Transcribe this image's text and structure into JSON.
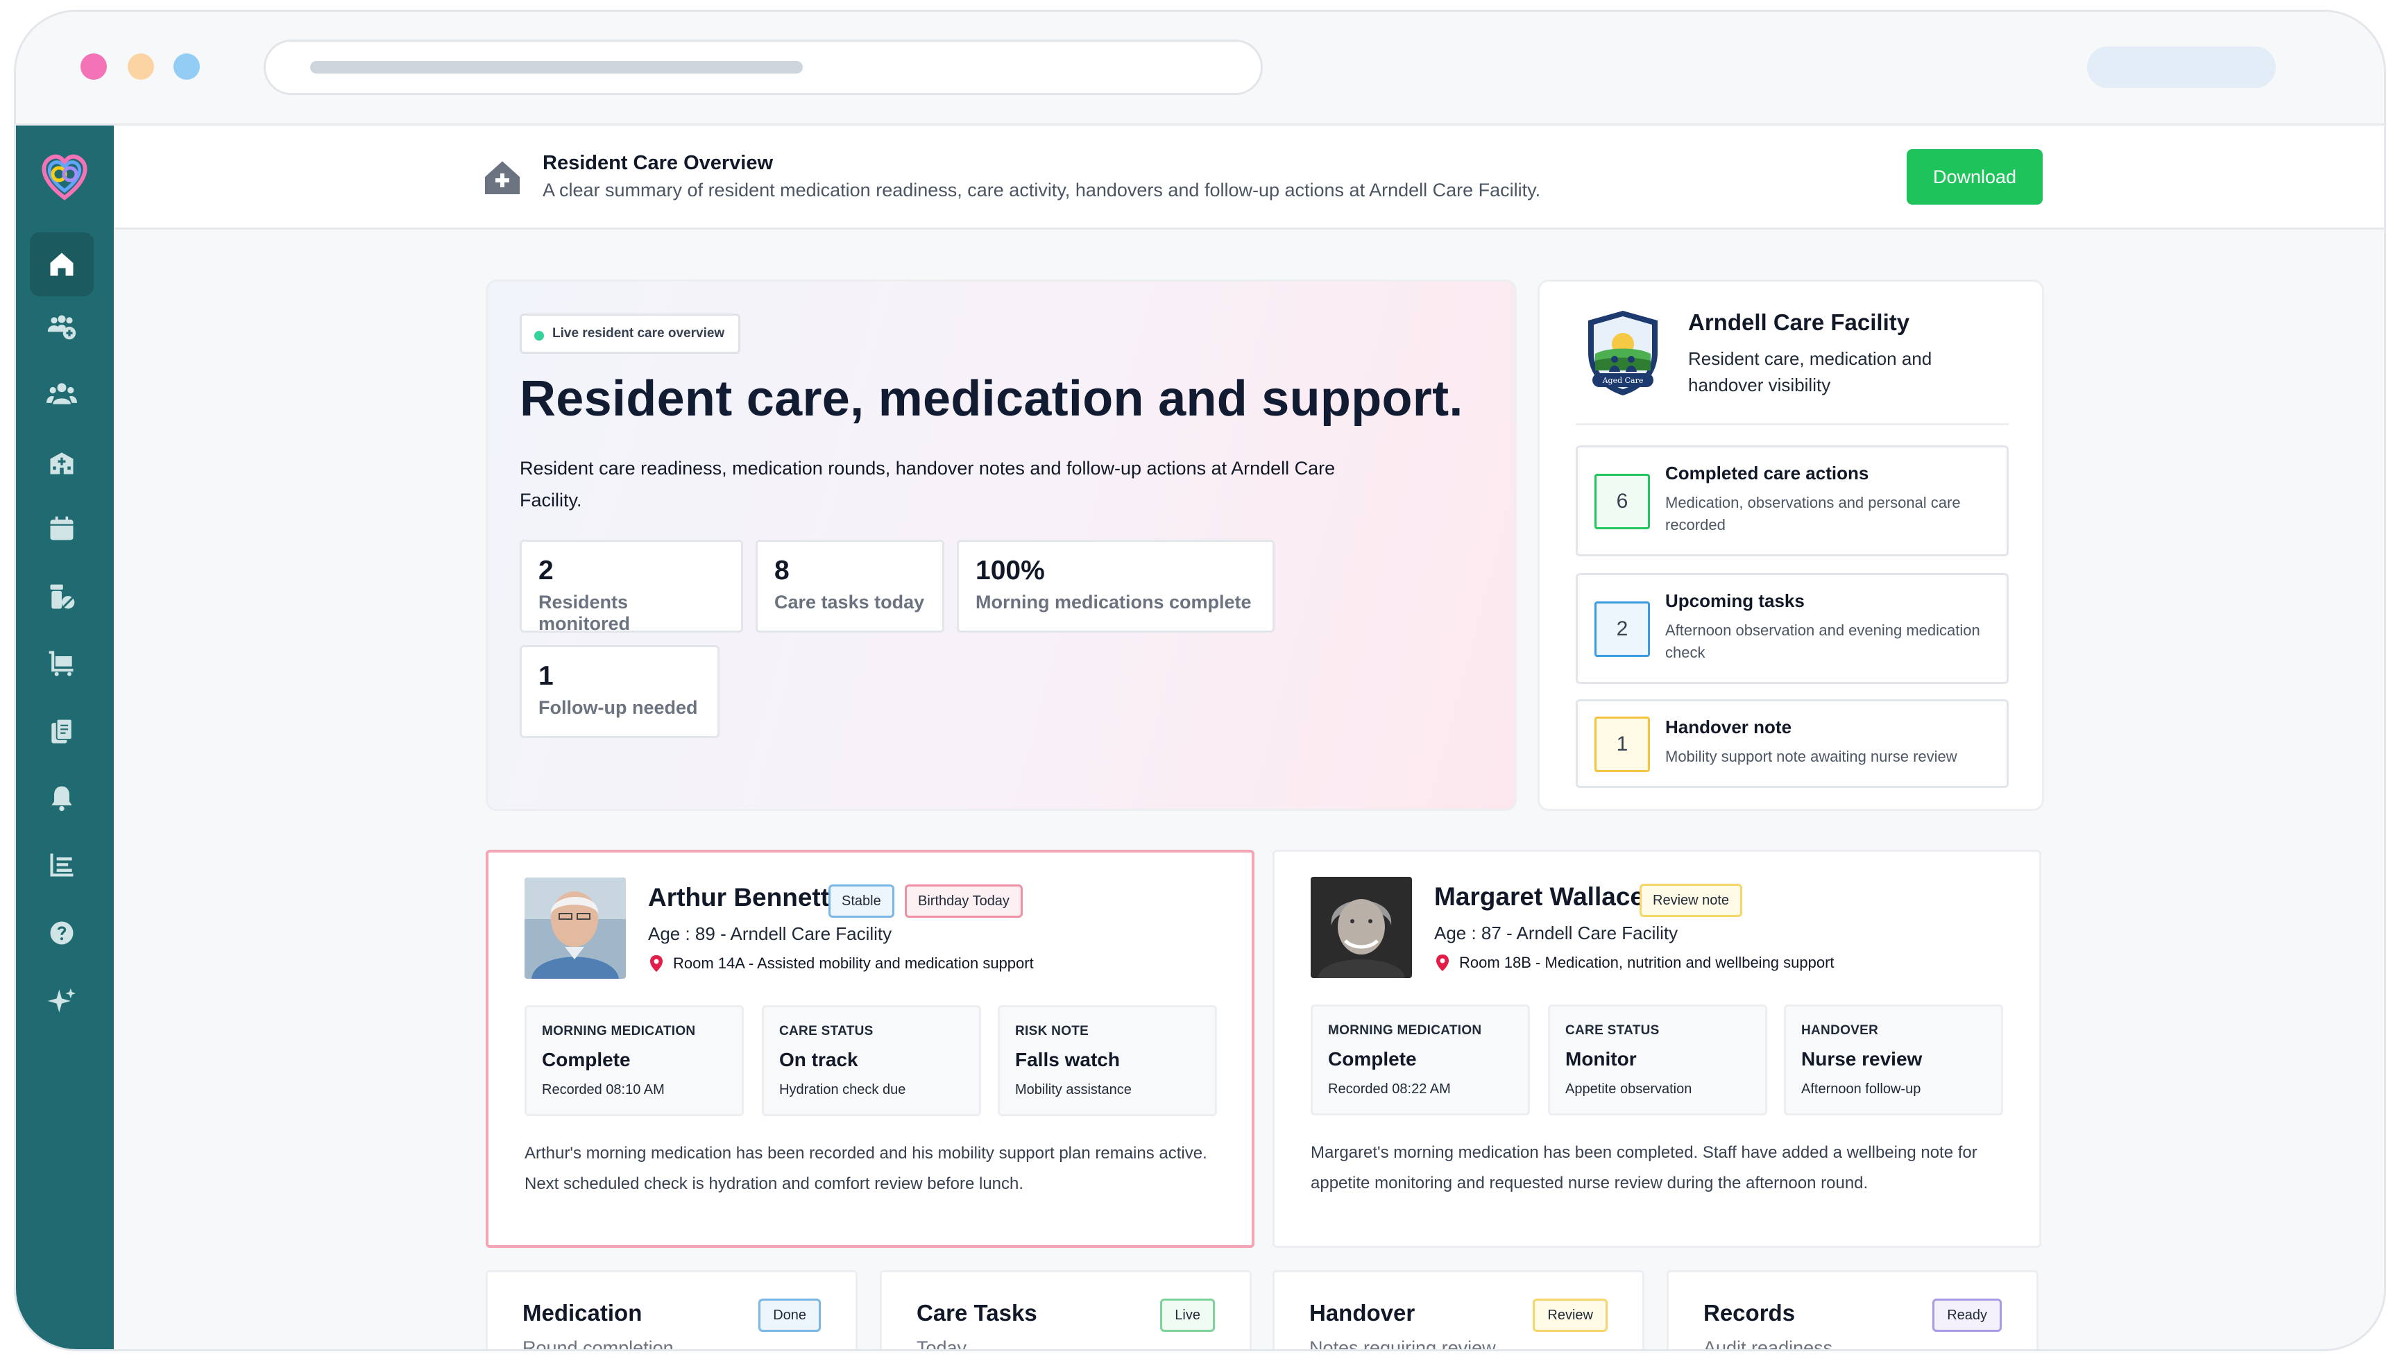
{
  "header": {
    "title": "Resident Care Overview",
    "subtitle": "A clear summary of resident medication readiness, care activity, handovers and follow-up actions at Arndell Care Facility.",
    "download_label": "Download"
  },
  "sidebar": {
    "items": [
      {
        "icon": "home-icon",
        "active": true
      },
      {
        "icon": "add-group-icon"
      },
      {
        "icon": "users-icon"
      },
      {
        "icon": "building-icon"
      },
      {
        "icon": "calendar-icon"
      },
      {
        "icon": "medication-icon"
      },
      {
        "icon": "cart-icon"
      },
      {
        "icon": "documents-icon"
      },
      {
        "icon": "bell-icon"
      },
      {
        "icon": "list-icon"
      },
      {
        "icon": "help-icon"
      },
      {
        "icon": "sparkle-icon"
      }
    ]
  },
  "hero": {
    "live_label": "Live resident care overview",
    "heading": "Resident care, medication and support.",
    "lead": "Resident care readiness, medication rounds, handover notes and follow-up actions at Arndell Care Facility.",
    "stats": [
      {
        "value": "2",
        "label": "Residents monitored"
      },
      {
        "value": "8",
        "label": "Care tasks today"
      },
      {
        "value": "100%",
        "label": "Morning medications complete"
      },
      {
        "value": "1",
        "label": "Follow-up needed"
      }
    ]
  },
  "facility": {
    "seal_text": "Aged Care",
    "name": "Arndell Care Facility",
    "description": "Resident care, medication and handover visibility",
    "tasks": [
      {
        "count": "6",
        "title": "Completed care actions",
        "detail": "Medication, observations and personal care recorded",
        "color": "#22c55e"
      },
      {
        "count": "2",
        "title": "Upcoming tasks",
        "detail": "Afternoon observation and evening medication check",
        "color": "#3b9be0"
      },
      {
        "count": "1",
        "title": "Handover note",
        "detail": "Mobility support note awaiting nurse review",
        "color": "#f5c542"
      }
    ]
  },
  "residents": [
    {
      "name": "Arthur Bennett",
      "tags": [
        "Stable",
        "Birthday Today"
      ],
      "age_line": "Age : 89 - Arndell Care Facility",
      "room": "Room 14A - Assisted mobility and medication support",
      "metrics": [
        {
          "key": "MORNING MEDICATION",
          "value": "Complete",
          "sub": "Recorded 08:10 AM"
        },
        {
          "key": "CARE STATUS",
          "value": "On track",
          "sub": "Hydration check due"
        },
        {
          "key": "RISK NOTE",
          "value": "Falls watch",
          "sub": "Mobility assistance"
        }
      ],
      "description": "Arthur's morning medication has been recorded and his mobility support plan remains active. Next scheduled check is hydration and comfort review before lunch."
    },
    {
      "name": "Margaret Wallace",
      "tags": [
        "Review note"
      ],
      "age_line": "Age : 87 - Arndell Care Facility",
      "room": "Room 18B - Medication, nutrition and wellbeing support",
      "metrics": [
        {
          "key": "MORNING MEDICATION",
          "value": "Complete",
          "sub": "Recorded 08:22 AM"
        },
        {
          "key": "CARE STATUS",
          "value": "Monitor",
          "sub": "Appetite observation"
        },
        {
          "key": "HANDOVER",
          "value": "Nurse review",
          "sub": "Afternoon follow-up"
        }
      ],
      "description": "Margaret's morning medication has been completed. Staff have added a wellbeing note for appetite monitoring and requested nurse review during the afternoon round."
    }
  ],
  "summary": [
    {
      "title": "Medication",
      "subtitle": "Round completion",
      "badge": "Done"
    },
    {
      "title": "Care Tasks",
      "subtitle": "Today",
      "badge": "Live"
    },
    {
      "title": "Handover",
      "subtitle": "Notes requiring review",
      "badge": "Review"
    },
    {
      "title": "Records",
      "subtitle": "Audit readiness",
      "badge": "Ready"
    }
  ]
}
